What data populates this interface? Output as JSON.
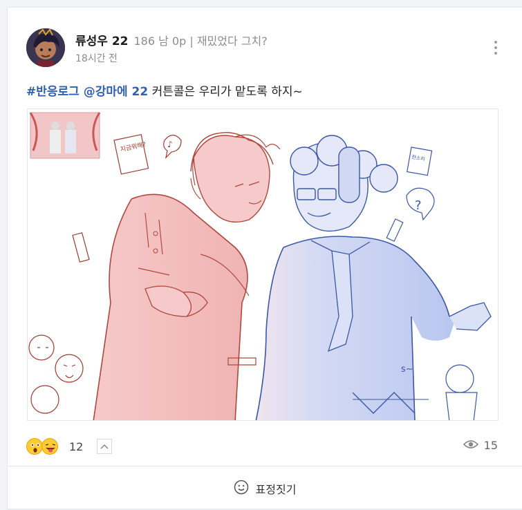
{
  "post": {
    "author": "류성우 22",
    "meta": "186 남 0p | 재밌었다 그치?",
    "time": "18시간 전",
    "text": {
      "tags": "#반응로그 @강마에 22",
      "body": " 커튼콜은 우리가 맡도록 하지~"
    },
    "image": {
      "doodles": [
        "지금뭐해?",
        "잔소리"
      ]
    }
  },
  "reactions": {
    "icons": [
      "surprised-emoji-icon",
      "tongue-wink-emoji-icon"
    ],
    "count": "12",
    "expand_icon": "chevron-up-icon"
  },
  "views": {
    "icon": "eye-icon",
    "count": "15"
  },
  "footer": {
    "icon": "smiley-icon",
    "label": "표정짓기"
  },
  "colors": {
    "tag": "#2f5fb3",
    "muted": "#8a8d93",
    "red_figure": "#f3b8b8",
    "blue_figure": "#c3cdf2"
  }
}
